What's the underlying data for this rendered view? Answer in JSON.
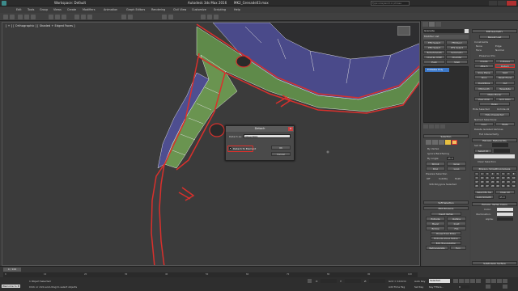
{
  "titlebar": {
    "workspace": "Workspace: Default",
    "app_title": "Autodesk 3ds Max 2016",
    "filename": "MK2_Grenade03.max",
    "search_placeholder": "Type a keyword or phrase"
  },
  "menus": [
    "Edit",
    "Tools",
    "Group",
    "Views",
    "Create",
    "Modifiers",
    "Animation",
    "Graph Editors",
    "Rendering",
    "Civil View",
    "Customize",
    "Scripting",
    "Help"
  ],
  "viewport": {
    "label": "[ + ] [ Orthographic ] [ Shaded + Edged Faces ]"
  },
  "dialog": {
    "title": "Detach",
    "name_label": "Detach as:",
    "name_value": "Object001",
    "checkbox_label": "Detach To Element",
    "ok": "OK",
    "cancel": "Cancel"
  },
  "panel": {
    "object_name": "Grenade",
    "modifier_list": "Modifier List",
    "stack_item": "Editable Poly",
    "left_buttons": [
      "FFD Select",
      "FFD(box)",
      "PFD Select",
      "PTS Select",
      "TurboSmooth",
      "Symmetry",
      "Unwrap UVW",
      "Chamfer",
      "Push",
      "Shell"
    ],
    "edit_geometry": "Edit Geometry",
    "repeat_last": "Repeat Last",
    "constraints": "Constraints",
    "constraint_opts": [
      "None",
      "Edge",
      "Face",
      "Normal"
    ],
    "preserve_uvs": "Preserve UVs",
    "create": "Create",
    "collapse": "Collapse",
    "attach": "Attach",
    "detach": "Detach",
    "slice_plane": "Slice Plane",
    "split": "Split",
    "slice": "Slice",
    "reset_plane": "Reset Plane",
    "quickslice": "QuickSlice",
    "cut": "Cut",
    "msmooth": "MSmooth",
    "tessellate": "Tessellate",
    "make_planar": "Make Planar",
    "view_align": "View Align",
    "grid_align": "Grid Align",
    "relax": "Relax",
    "hide_selected": "Hide Selected",
    "unhide_all": "Unhide All",
    "hide_unselected": "Hide Unselected",
    "named_selections": "Named Selections:",
    "copy": "Copy",
    "paste": "Paste",
    "delete_isolated": "Delete Isolated Vertices",
    "full_interactivity": "Full Interactivity",
    "selection": "Selection",
    "by_vertex": "By Vertex",
    "ignore_backfacing": "Ignore Backfacing",
    "by_angle": "By Angle:",
    "angle_value": "45.0",
    "shrink": "Shrink",
    "grow": "Grow",
    "ring": "Ring",
    "loop": "Loop",
    "preview_selection": "Preview Selection",
    "preview_opts": [
      "Off",
      "SubObj",
      "Multi"
    ],
    "selected_count": "326 Polygons Selected",
    "soft_selection": "Soft Selection",
    "edit_polygons": "Edit Polygons",
    "insert_vertex": "Insert Vertex",
    "extrude": "Extrude",
    "outline": "Outline",
    "bevel": "Bevel",
    "inset": "Inset",
    "bridge": "Bridge",
    "flip": "Flip",
    "hinge_from_edge": "Hinge From Edge",
    "extrude_along_spline": "Extrude Along Spline",
    "edit_triangulation": "Edit Triangulation",
    "retriangulate": "Retriangulate",
    "turn": "Turn",
    "material_ids": "Polygon: Material IDs",
    "set_id": "Set ID:",
    "select_id": "Select ID",
    "clear_selection": "Clear Selection",
    "smoothing_groups": "Polygon: Smoothing Groups",
    "sg_numbers": [
      "1",
      "2",
      "3",
      "4",
      "5",
      "6",
      "7",
      "8",
      "9",
      "10",
      "11",
      "12",
      "13",
      "14",
      "15",
      "16",
      "17",
      "18",
      "19",
      "20",
      "21",
      "22",
      "23",
      "24",
      "25",
      "26",
      "27",
      "28",
      "29",
      "30",
      "31",
      "32"
    ],
    "select_by_sg": "Select By SG",
    "clear_all": "Clear All",
    "auto_smooth": "Auto Smooth",
    "auto_smooth_value": "45.0",
    "vertex_colors": "Polygon: Vertex Colors",
    "color": "Color:",
    "illumination": "Illumination:",
    "alpha": "Alpha:",
    "subdivision_surface": "Subdivision Surface",
    "smooth_result": "Smooth Result"
  },
  "timeline": {
    "frame": "0 / 100",
    "ticks": [
      "0",
      "5",
      "10",
      "15",
      "20",
      "25",
      "30",
      "35",
      "40",
      "45",
      "50",
      "55",
      "60",
      "65",
      "70",
      "75",
      "80",
      "85",
      "90",
      "95",
      "100"
    ]
  },
  "status": {
    "welcome": "Welcome to M",
    "objects_selected": "1 Object Selected",
    "hint": "Click or click-and-drag to select objects",
    "x": "X:",
    "y": "Y:",
    "z": "Z:",
    "grid": "Grid = 10.0cm",
    "add_time_tag": "Add Time Tag",
    "auto_key": "Auto Key",
    "selected": "Selected",
    "set_key": "Set Key",
    "key_filters": "Key Filters...",
    "frame_value": "0"
  }
}
